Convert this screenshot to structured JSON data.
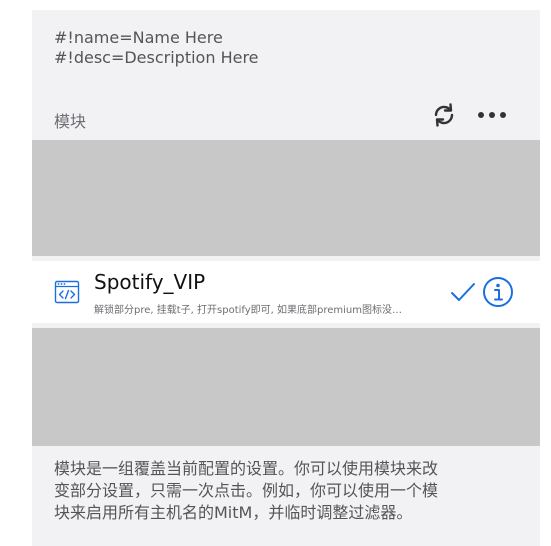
{
  "config": {
    "lines": [
      "#!name=Name Here",
      "#!desc=Description Here"
    ]
  },
  "section": {
    "title": "模块"
  },
  "toolbar": {
    "refresh_icon": "refresh-icon",
    "more_icon": "more-icon"
  },
  "modules": [
    {
      "name": "Spotify_VIP",
      "description": "解锁部分pre, 挂载t子, 打开spotify即可, 如果底部premium图标没…",
      "icon": "code-window-icon",
      "enabled": true,
      "check_icon": "checkmark-icon",
      "info_icon": "info-icon"
    }
  ],
  "footer": {
    "lines": [
      "模块是一组覆盖当前配置的设置。你可以使用模块来改",
      "变部分设置，只需一次点击。例如，你可以使用一个模",
      "块来启用所有主机名的MitM，并临时调整过滤器。"
    ]
  },
  "colors": {
    "accent": "#1a6fe0",
    "panel_background": "#f2f2f4",
    "placeholder_gray": "#c8c8c8"
  }
}
